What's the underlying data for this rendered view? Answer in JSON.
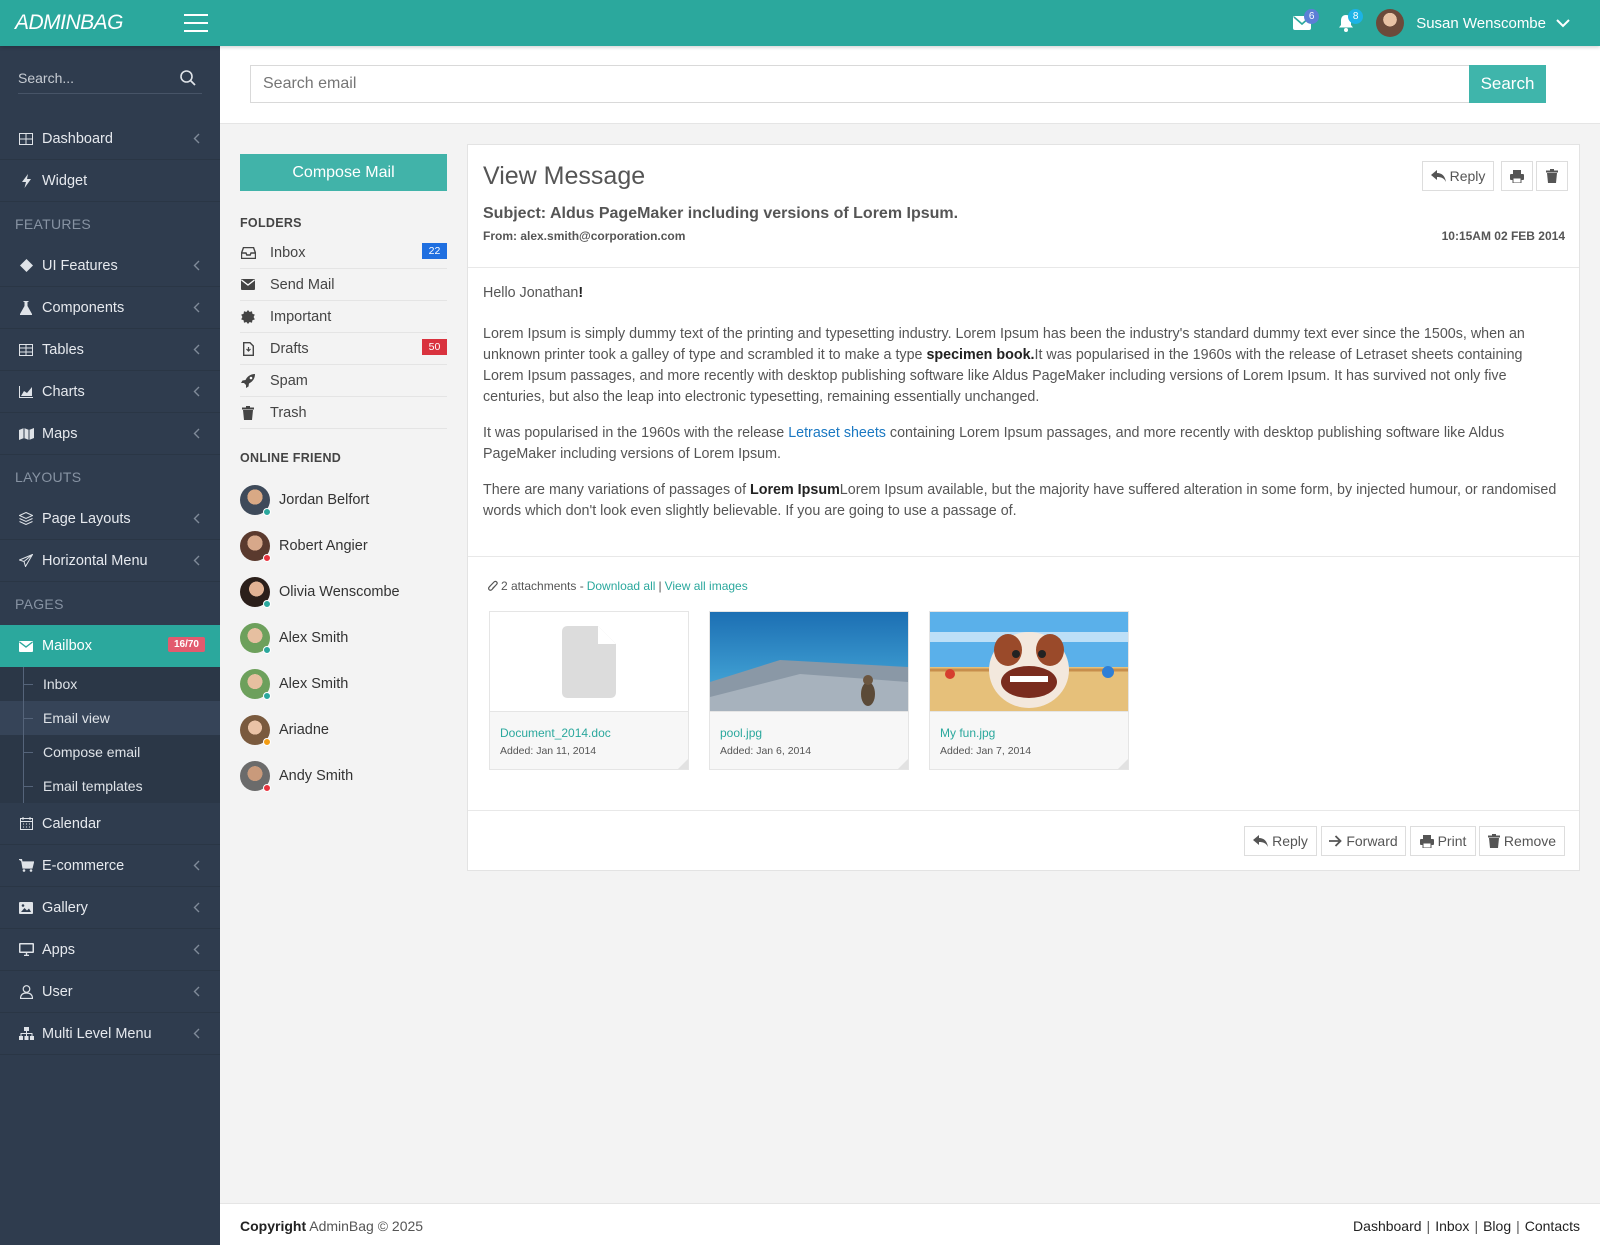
{
  "header": {
    "logo": "ADMINBAG",
    "mail_count": "6",
    "notif_count": "8",
    "user_name": "Susan Wenscombe"
  },
  "sidebar": {
    "search_placeholder": "Search...",
    "items": [
      {
        "label": "Dashboard",
        "icon": "grid-icon",
        "chevron": true
      },
      {
        "label": "Widget",
        "icon": "bolt-icon",
        "chevron": false
      },
      {
        "heading": "FEATURES"
      },
      {
        "label": "UI Features",
        "icon": "diamond-icon",
        "chevron": true
      },
      {
        "label": "Components",
        "icon": "flask-icon",
        "chevron": true
      },
      {
        "label": "Tables",
        "icon": "table-icon",
        "chevron": true
      },
      {
        "label": "Charts",
        "icon": "chart-icon",
        "chevron": true
      },
      {
        "label": "Maps",
        "icon": "map-icon",
        "chevron": true
      },
      {
        "heading": "LAYOUTS"
      },
      {
        "label": "Page Layouts",
        "icon": "layers-icon",
        "chevron": true
      },
      {
        "label": "Horizontal Menu",
        "icon": "send-icon",
        "chevron": true
      },
      {
        "heading": "PAGES"
      }
    ],
    "mailbox": {
      "label": "Mailbox",
      "badge": "16/70"
    },
    "mailbox_sub": [
      "Inbox",
      "Email view",
      "Compose email",
      "Email templates"
    ],
    "items_after": [
      {
        "label": "Calendar",
        "icon": "calendar-icon",
        "chevron": false
      },
      {
        "label": "E-commerce",
        "icon": "cart-icon",
        "chevron": true
      },
      {
        "label": "Gallery",
        "icon": "image-icon",
        "chevron": true
      },
      {
        "label": "Apps",
        "icon": "monitor-icon",
        "chevron": true
      },
      {
        "label": "User",
        "icon": "user-icon",
        "chevron": true
      },
      {
        "label": "Multi Level Menu",
        "icon": "sitemap-icon",
        "chevron": true
      }
    ]
  },
  "search": {
    "placeholder": "Search email",
    "button": "Search"
  },
  "mail": {
    "compose": "Compose Mail",
    "folders_title": "FOLDERS",
    "folders": [
      {
        "label": "Inbox",
        "icon": "inbox-icon",
        "badge": "22",
        "badge_color": "#1f6fe0"
      },
      {
        "label": "Send Mail",
        "icon": "envelope-icon",
        "badge": "",
        "badge_color": ""
      },
      {
        "label": "Important",
        "icon": "certificate-icon",
        "badge": "",
        "badge_color": ""
      },
      {
        "label": "Drafts",
        "icon": "file-icon",
        "badge": "50",
        "badge_color": "#d9323e"
      },
      {
        "label": "Spam",
        "icon": "rocket-icon",
        "badge": "",
        "badge_color": ""
      },
      {
        "label": "Trash",
        "icon": "trash-icon",
        "badge": "",
        "badge_color": ""
      }
    ],
    "friends_title": "ONLINE FRIEND",
    "friends": [
      {
        "name": "Jordan Belfort",
        "status_color": "#2ba89d"
      },
      {
        "name": "Robert Angier",
        "status_color": "#e8343f"
      },
      {
        "name": "Olivia Wenscombe",
        "status_color": "#2ba89d"
      },
      {
        "name": "Alex Smith",
        "status_color": "#2ba89d"
      },
      {
        "name": "Alex Smith",
        "status_color": "#2ba89d"
      },
      {
        "name": "Ariadne",
        "status_color": "#f39c12"
      },
      {
        "name": "Andy Smith",
        "status_color": "#e8343f"
      }
    ]
  },
  "message": {
    "title": "View Message",
    "reply": "Reply",
    "subject": "Subject: Aldus PageMaker including versions of Lorem Ipsum.",
    "from": "From: alex.smith@corporation.com",
    "date": "10:15AM 02 FEB 2014",
    "greeting_name": "Hello Jonathan",
    "greeting_mark": "!",
    "p1_a": "Lorem Ipsum is simply dummy text of the printing and typesetting industry. Lorem Ipsum has been the industry's standard dummy text ever since the 1500s, when an unknown printer took a galley of type and scrambled it to make a type ",
    "p1_b": "specimen book.",
    "p1_c": "It was popularised in the 1960s with the release of Letraset sheets containing Lorem Ipsum passages, and more recently with desktop publishing software like Aldus PageMaker including versions of Lorem Ipsum. It has survived not only five centuries, but also the leap into electronic typesetting, remaining essentially unchanged.",
    "p2_a": "It was popularised in the 1960s with the release ",
    "p2_link": "Letraset sheets",
    "p2_c": " containing Lorem Ipsum passages, and more recently with desktop publishing software like Aldus PageMaker including versions of Lorem Ipsum.",
    "p3_a": "There are many variations of passages of ",
    "p3_b": "Lorem Ipsum",
    "p3_c": "Lorem Ipsum available, but the majority have suffered alteration in some form, by injected humour, or randomised words which don't look even slightly believable. If you are going to use a passage of.",
    "attach_count": "2 attachments - ",
    "download_all": "Download all",
    "sep": "|",
    "view_images": "View all images",
    "attachments": [
      {
        "name": "Document_2014.doc",
        "added": "Added: Jan 11, 2014"
      },
      {
        "name": "pool.jpg",
        "added": "Added: Jan 6, 2014"
      },
      {
        "name": "My fun.jpg",
        "added": "Added: Jan 7, 2014"
      }
    ],
    "actions": {
      "reply": "Reply",
      "forward": "Forward",
      "print": "Print",
      "remove": "Remove"
    }
  },
  "footer": {
    "copy_bold": "Copyright",
    "copy_rest": " AdminBag © 2025",
    "links": [
      "Dashboard",
      "Inbox",
      "Blog",
      "Contacts"
    ],
    "sep": "|"
  }
}
